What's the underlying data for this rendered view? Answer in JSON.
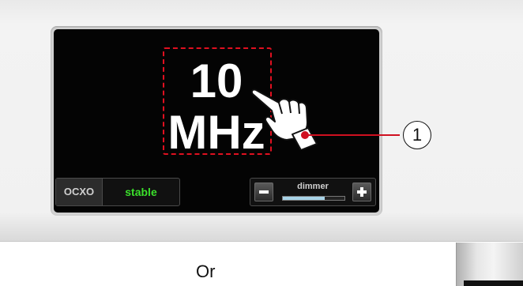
{
  "display": {
    "frequency_value": "10",
    "frequency_unit": "MHz"
  },
  "status": {
    "oscillator_label": "OCXO",
    "state": "stable",
    "state_color": "#3bdf2b"
  },
  "dimmer": {
    "label": "dimmer",
    "level_fraction": 0.68,
    "fill_color": "#a8d4e8"
  },
  "callout": {
    "number": "1",
    "color": "#d01020"
  },
  "footer": {
    "or_text": "Or"
  },
  "icons": [
    "hand-pointer-icon",
    "minus-icon",
    "plus-icon"
  ]
}
